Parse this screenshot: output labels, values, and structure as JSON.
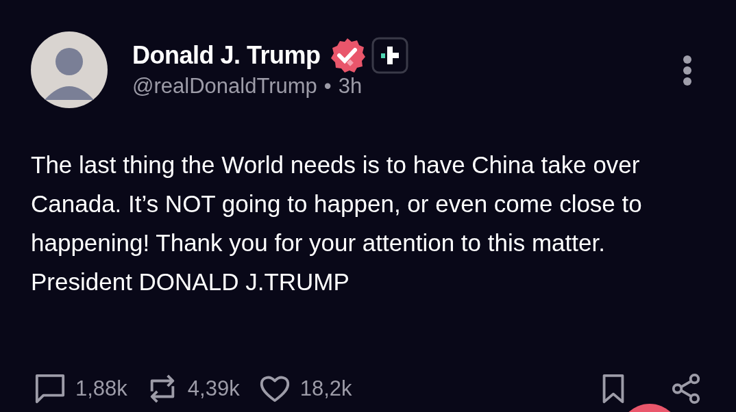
{
  "post": {
    "author": {
      "name": "Donald J. Trump",
      "verified": true,
      "handle": "@realDonaldTrump",
      "separator": "•",
      "time": "3h"
    },
    "text": "The last thing the World needs is to have China take over Canada. It’s NOT going to happen, or even come close to happening! Thank you for your attention to this matter. President DONALD J.TRUMP",
    "actions": [
      {
        "kind": "reply",
        "count": "1,88k"
      },
      {
        "kind": "repost",
        "count": "4,39k"
      },
      {
        "kind": "like",
        "count": "18,2k"
      }
    ]
  }
}
